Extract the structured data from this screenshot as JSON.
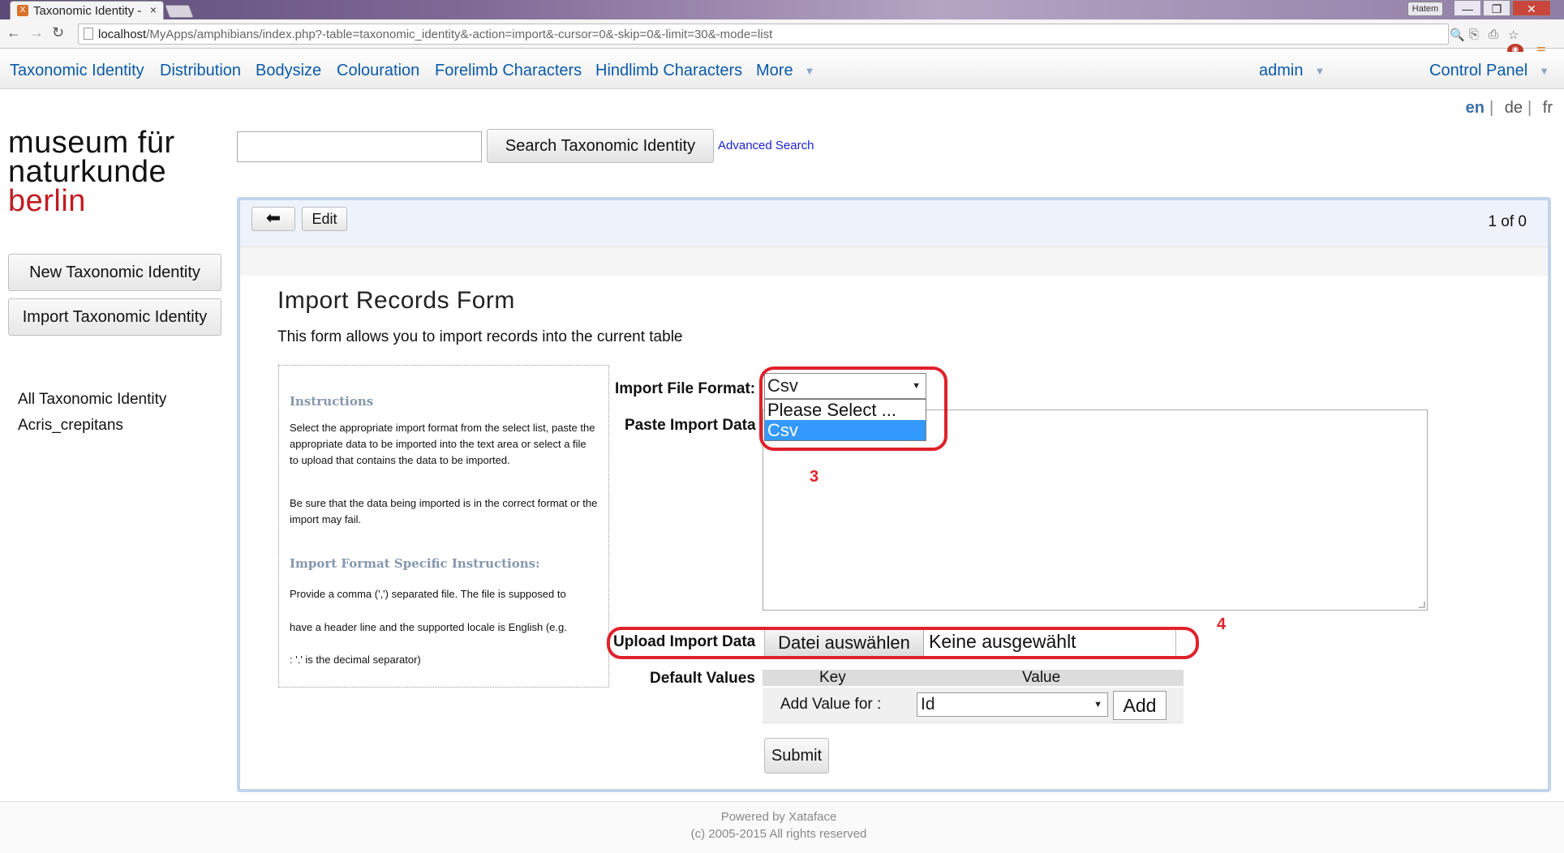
{
  "browser": {
    "tab_title": "Taxonomic Identity -",
    "tab_close": "×",
    "profile_name": "Hatem",
    "url_host": "localhost",
    "url_path": "/MyApps/amphibians/index.php?-table=taxonomic_identity&-action=import&-cursor=0&-skip=0&-limit=30&-mode=list"
  },
  "nav": {
    "items": [
      "Taxonomic Identity",
      "Distribution",
      "Bodysize",
      "Colouration",
      "Forelimb Characters",
      "Hindlimb Characters",
      "More"
    ],
    "user": "admin",
    "control_panel": "Control Panel"
  },
  "languages": {
    "en": "en",
    "de": "de",
    "fr": "fr",
    "separator": "|"
  },
  "logo": {
    "line1": "museum für",
    "line2": "naturkunde",
    "line3": "berlin"
  },
  "search": {
    "value": "",
    "button_label": "Search Taxonomic Identity",
    "advanced_label": "Advanced Search"
  },
  "sidebar": {
    "buttons": [
      "New Taxonomic Identity",
      "Import Taxonomic Identity"
    ],
    "links": [
      "All Taxonomic Identity",
      "Acris_crepitans"
    ]
  },
  "toolbar": {
    "back_icon": "arrow-left",
    "back_glyph": "⬅",
    "edit_label": "Edit",
    "pager": "1 of 0"
  },
  "form": {
    "title": "Import Records Form",
    "description": "This form allows you to import records into the current table",
    "instructions": {
      "heading": "Instructions",
      "p1": "Select the appropriate import format from the select list, paste the appropriate data to be imported into the text area or select a file to upload that contains the data to be imported.",
      "p2": "Be sure that the data being imported is in the correct format or the import may fail.",
      "heading2": "Import Format Specific Instructions:",
      "p3a": "Provide a comma (',') separated file. The file is supposed to",
      "p3b": "have a header line and the supported locale is English (e.g.",
      "p3c": ": '.' is the decimal separator)"
    },
    "import_format_label": "Import File Format:",
    "import_format_value": "Csv",
    "import_format_options": [
      "Please Select ...",
      "Csv"
    ],
    "paste_label": "Paste Import Data",
    "paste_value": "",
    "upload_label": "Upload Import Data",
    "upload_button": "Datei auswählen",
    "upload_status": "Keine ausgewählt",
    "defaults_label": "Default Values",
    "defaults_headers": [
      "Key",
      "Value"
    ],
    "add_value_label": "Add Value for :",
    "add_value_select": "Id",
    "add_button": "Add",
    "submit_label": "Submit"
  },
  "annotations": {
    "step3": "3",
    "step4": "4",
    "color": "#e0212a"
  },
  "footer": {
    "line1": "Powered by Xataface",
    "line2": "(c) 2005-2015 All rights reserved"
  }
}
